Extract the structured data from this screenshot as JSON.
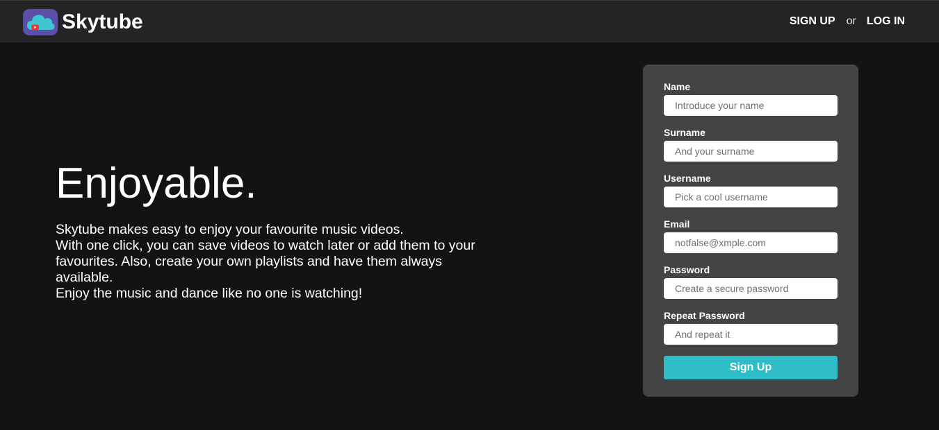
{
  "header": {
    "brand_name": "Skytube",
    "logo_icon": "cloud-play-icon",
    "signup_link": "SIGN UP",
    "or_text": "or",
    "login_link": "LOG IN"
  },
  "hero": {
    "title": "Enjoyable.",
    "paragraphs": [
      "Skytube makes easy to enjoy your favourite music videos.",
      "With one click, you can save videos to watch later or add them to your favourites. Also, create your own playlists and have them always available.",
      "Enjoy the music and dance like no one is watching!"
    ]
  },
  "form": {
    "fields": [
      {
        "label": "Name",
        "placeholder": "Introduce your name",
        "value": ""
      },
      {
        "label": "Surname",
        "placeholder": "And your surname",
        "value": ""
      },
      {
        "label": "Username",
        "placeholder": "Pick a cool username",
        "value": ""
      },
      {
        "label": "Email",
        "placeholder": "notfalse@xmple.com",
        "value": ""
      },
      {
        "label": "Password",
        "placeholder": "Create a secure password",
        "value": ""
      },
      {
        "label": "Repeat Password",
        "placeholder": "And repeat it",
        "value": ""
      }
    ],
    "submit_label": "Sign Up"
  },
  "colors": {
    "background": "#131313",
    "navbar": "#242424",
    "card": "#444444",
    "accent": "#2ebcc6",
    "logo_bg": "#5b4fa8",
    "cloud": "#3fc6d0",
    "play": "#e53935"
  }
}
